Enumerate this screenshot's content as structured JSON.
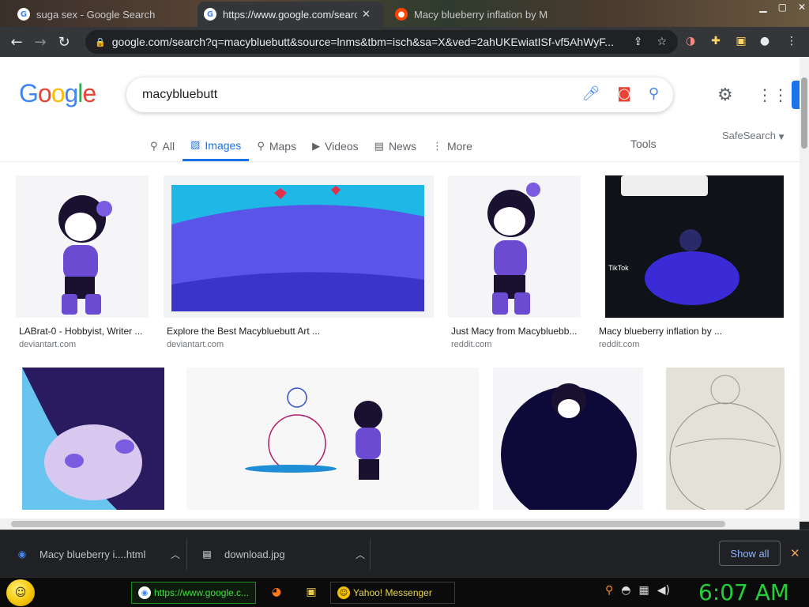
{
  "browser": {
    "tabs": [
      {
        "title": "suga sex - Google Search",
        "favicon": "google-icon"
      },
      {
        "title": "https://www.google.com/search?",
        "favicon": "google-icon"
      },
      {
        "title": "Macy blueberry inflation by Ms",
        "favicon": "reddit-icon"
      }
    ],
    "url": "google.com/search?q=macybluebutt&source=lnms&tbm=isch&sa=X&ved=2ahUKEwiatISf-vf5AhWyF..."
  },
  "google": {
    "logo_letters": [
      "G",
      "o",
      "o",
      "g",
      "l",
      "e"
    ],
    "query": "macybluebutt",
    "tabs": [
      {
        "label": "All",
        "icon": "search-icon"
      },
      {
        "label": "Images",
        "icon": "image-icon"
      },
      {
        "label": "Maps",
        "icon": "map-pin-icon"
      },
      {
        "label": "Videos",
        "icon": "play-icon"
      },
      {
        "label": "News",
        "icon": "news-icon"
      },
      {
        "label": "More",
        "icon": "more-vert-icon"
      }
    ],
    "tools_label": "Tools",
    "safesearch_label": "SafeSearch"
  },
  "results": [
    {
      "title": "LABrat-0 - Hobbyist, Writer ...",
      "source": "deviantart.com"
    },
    {
      "title": "Explore the Best Macybluebutt Art ...",
      "source": "deviantart.com"
    },
    {
      "title": "Just Macy from Macybluebb...",
      "source": "reddit.com"
    },
    {
      "title": "Macy blueberry inflation by ...",
      "source": "reddit.com"
    }
  ],
  "downloads": {
    "items": [
      {
        "name": "Macy blueberry i....html"
      },
      {
        "name": "download.jpg"
      }
    ],
    "show_all_label": "Show all"
  },
  "taskbar": {
    "chrome_label": "https://www.google.c...",
    "yahoo_label": "Yahoo! Messenger",
    "clock": "6:07 AM"
  },
  "colors": {
    "accent": "#1a73e8",
    "clock": "#22d13a"
  }
}
